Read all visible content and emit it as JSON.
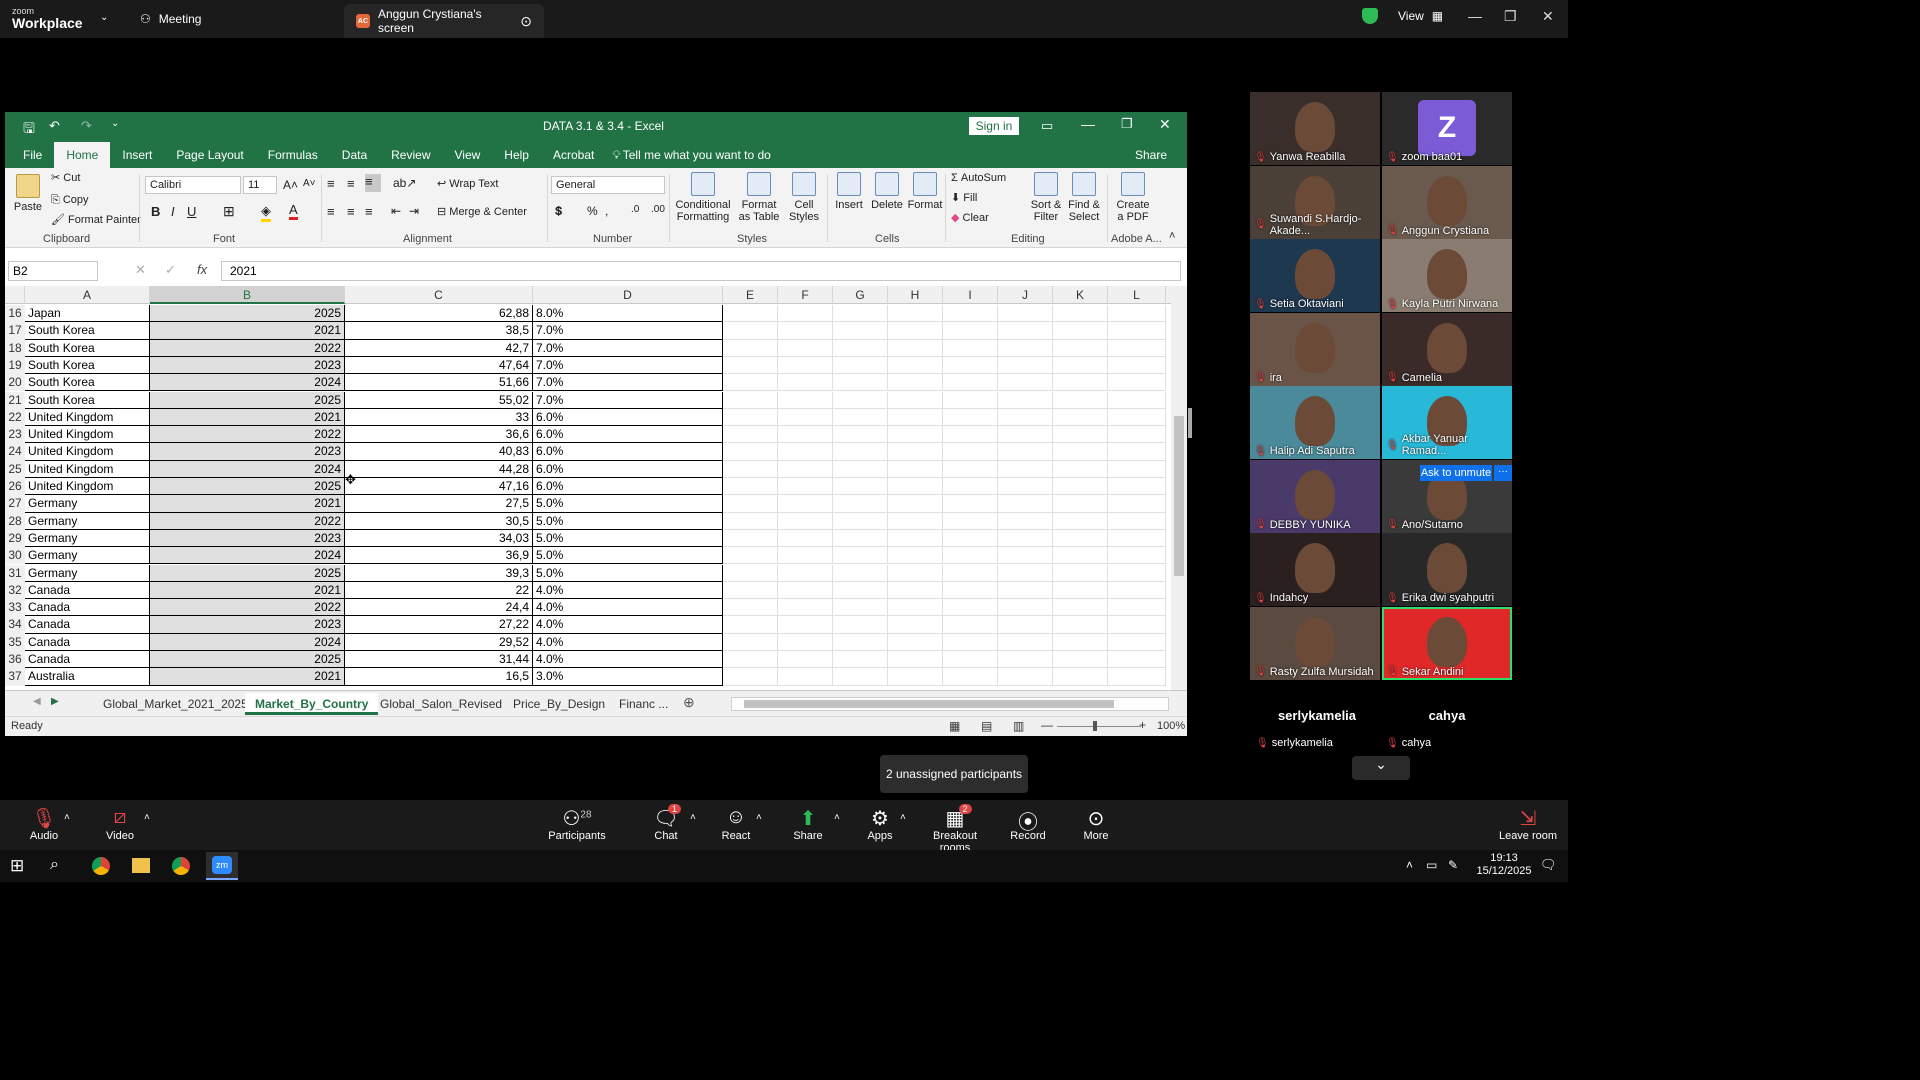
{
  "zoom": {
    "brand_top": "zoom",
    "brand_bottom": "Workplace",
    "meeting_tab": "Meeting",
    "share_tab": "Anggun Crystiana's screen",
    "share_badge": "AC",
    "view_label": "View",
    "tooltip": "2 unassigned participants",
    "ask_unmute": "Ask to unmute",
    "toolbar": {
      "audio": "Audio",
      "video": "Video",
      "participants": "Participants",
      "participants_count": "28",
      "chat": "Chat",
      "chat_badge": "1",
      "react": "React",
      "share": "Share",
      "apps": "Apps",
      "breakout": "Breakout rooms",
      "breakout_badge": "2",
      "record": "Record",
      "more": "More",
      "leave": "Leave room"
    },
    "participants": [
      {
        "name": "Yanwa Reabilla"
      },
      {
        "name": "zoom baa01",
        "avatar": "Z"
      },
      {
        "name": "Suwandi S.Hardjo-Akade..."
      },
      {
        "name": "Anggun Crystiana"
      },
      {
        "name": "Setia Oktaviani"
      },
      {
        "name": "Kayla Putri Nirwana"
      },
      {
        "name": "ira"
      },
      {
        "name": "Camelia"
      },
      {
        "name": "Halip Adi Saputra"
      },
      {
        "name": "Akbar Yanuar Ramad..."
      },
      {
        "name": "DEBBY YUNIKA"
      },
      {
        "name": "Ano/Sutarno"
      },
      {
        "name": "Indahcy"
      },
      {
        "name": "Erika dwi syahputri"
      },
      {
        "name": "Rasty Zulfa Mursidah"
      },
      {
        "name": "Sekar Andini"
      }
    ],
    "audio_only": [
      {
        "big": "serlykamelia",
        "small": "serlykamelia"
      },
      {
        "big": "cahya",
        "small": "cahya"
      }
    ]
  },
  "excel": {
    "title": "DATA 3.1 & 3.4  -  Excel",
    "sign_in": "Sign in",
    "tabs": [
      "File",
      "Home",
      "Insert",
      "Page Layout",
      "Formulas",
      "Data",
      "Review",
      "View",
      "Help",
      "Acrobat"
    ],
    "tell_me": "Tell me what you want to do",
    "share": "Share",
    "ribbon": {
      "paste": "Paste",
      "cut": "Cut",
      "copy": "Copy",
      "format_painter": "Format Painter",
      "clipboard": "Clipboard",
      "font_name": "Calibri",
      "font_size": "11",
      "font": "Font",
      "wrap": "Wrap Text",
      "merge": "Merge & Center",
      "alignment": "Alignment",
      "number_format": "General",
      "number": "Number",
      "cond_fmt": "Conditional Formatting",
      "fmt_table": "Format as Table",
      "cell_styles": "Cell Styles",
      "styles": "Styles",
      "insert": "Insert",
      "delete": "Delete",
      "format": "Format",
      "cells": "Cells",
      "autosum": "AutoSum",
      "fill": "Fill",
      "clear": "Clear",
      "sort": "Sort & Filter",
      "find": "Find & Select",
      "editing": "Editing",
      "create_pdf": "Create a PDF",
      "adobe": "Adobe A..."
    },
    "name_box": "B2",
    "formula": "2021",
    "columns": [
      "A",
      "B",
      "C",
      "D",
      "E",
      "F",
      "G",
      "H",
      "I",
      "J",
      "K",
      "L"
    ],
    "rows": [
      {
        "n": "16",
        "a": "Japan",
        "b": "2025",
        "c": "62,88",
        "d": "8.0%"
      },
      {
        "n": "17",
        "a": "South Korea",
        "b": "2021",
        "c": "38,5",
        "d": "7.0%"
      },
      {
        "n": "18",
        "a": "South Korea",
        "b": "2022",
        "c": "42,7",
        "d": "7.0%"
      },
      {
        "n": "19",
        "a": "South Korea",
        "b": "2023",
        "c": "47,64",
        "d": "7.0%"
      },
      {
        "n": "20",
        "a": "South Korea",
        "b": "2024",
        "c": "51,66",
        "d": "7.0%"
      },
      {
        "n": "21",
        "a": "South Korea",
        "b": "2025",
        "c": "55,02",
        "d": "7.0%"
      },
      {
        "n": "22",
        "a": "United Kingdom",
        "b": "2021",
        "c": "33",
        "d": "6.0%"
      },
      {
        "n": "23",
        "a": "United Kingdom",
        "b": "2022",
        "c": "36,6",
        "d": "6.0%"
      },
      {
        "n": "24",
        "a": "United Kingdom",
        "b": "2023",
        "c": "40,83",
        "d": "6.0%"
      },
      {
        "n": "25",
        "a": "United Kingdom",
        "b": "2024",
        "c": "44,28",
        "d": "6.0%"
      },
      {
        "n": "26",
        "a": "United Kingdom",
        "b": "2025",
        "c": "47,16",
        "d": "6.0%"
      },
      {
        "n": "27",
        "a": "Germany",
        "b": "2021",
        "c": "27,5",
        "d": "5.0%"
      },
      {
        "n": "28",
        "a": "Germany",
        "b": "2022",
        "c": "30,5",
        "d": "5.0%"
      },
      {
        "n": "29",
        "a": "Germany",
        "b": "2023",
        "c": "34,03",
        "d": "5.0%"
      },
      {
        "n": "30",
        "a": "Germany",
        "b": "2024",
        "c": "36,9",
        "d": "5.0%"
      },
      {
        "n": "31",
        "a": "Germany",
        "b": "2025",
        "c": "39,3",
        "d": "5.0%"
      },
      {
        "n": "32",
        "a": "Canada",
        "b": "2021",
        "c": "22",
        "d": "4.0%"
      },
      {
        "n": "33",
        "a": "Canada",
        "b": "2022",
        "c": "24,4",
        "d": "4.0%"
      },
      {
        "n": "34",
        "a": "Canada",
        "b": "2023",
        "c": "27,22",
        "d": "4.0%"
      },
      {
        "n": "35",
        "a": "Canada",
        "b": "2024",
        "c": "29,52",
        "d": "4.0%"
      },
      {
        "n": "36",
        "a": "Canada",
        "b": "2025",
        "c": "31,44",
        "d": "4.0%"
      },
      {
        "n": "37",
        "a": "Australia",
        "b": "2021",
        "c": "16,5",
        "d": "3.0%"
      }
    ],
    "sheets": [
      "Global_Market_2021_2025",
      "Market_By_Country",
      "Global_Salon_Revised",
      "Price_By_Design",
      "Financ ..."
    ],
    "status": "Ready",
    "zoom": "100%"
  },
  "taskbar": {
    "time": "19:13",
    "date": "15/12/2025"
  }
}
